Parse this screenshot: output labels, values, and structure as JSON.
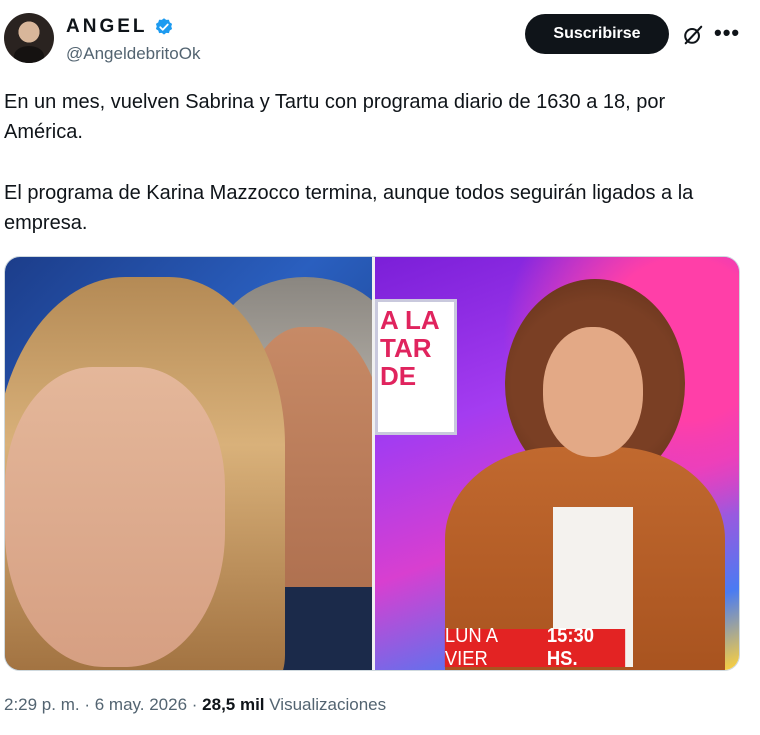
{
  "author": {
    "name": "ANGEL",
    "handle": "@AngeldebritoOk",
    "verified_color": "#1d9bf0"
  },
  "actions": {
    "subscribe_label": "Suscribirse",
    "grok_icon": "grok-icon",
    "more_icon": "more-icon"
  },
  "tweet": {
    "paragraph1": "En un mes, vuelven Sabrina y Tartu con programa diario de 1630 a 18, por América.",
    "paragraph2": "El programa de Karina Mazzocco termina, aunque todos seguirán ligados a la empresa."
  },
  "media": {
    "right_sign_text": "A LA TAR DE",
    "banner_days": "LUN A VIER",
    "banner_time": "15:30 HS."
  },
  "meta": {
    "time": "2:29 p. m.",
    "date": "6 may. 2026",
    "views_count": "28,5 mil",
    "views_label": "Visualizaciones"
  }
}
